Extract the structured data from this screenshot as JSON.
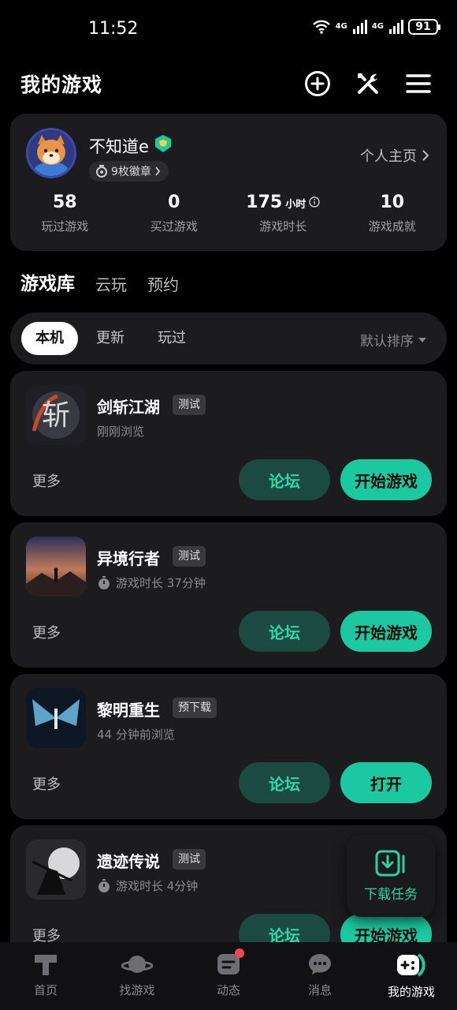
{
  "status_bar": {
    "time": "11:52",
    "signal_1": "4G",
    "signal_2": "4G",
    "battery": "91"
  },
  "header": {
    "title": "我的游戏"
  },
  "profile": {
    "username": "不知道e",
    "medals": "9枚徽章",
    "homepage_link": "个人主页",
    "stats": [
      {
        "value": "58",
        "unit": "",
        "label": "玩过游戏"
      },
      {
        "value": "0",
        "unit": "",
        "label": "买过游戏"
      },
      {
        "value": "175",
        "unit": "小时",
        "label": "游戏时长"
      },
      {
        "value": "10",
        "unit": "",
        "label": "游戏成就"
      }
    ]
  },
  "tabs": [
    "游戏库",
    "云玩",
    "预约"
  ],
  "filters": {
    "items": [
      "本机",
      "更新",
      "玩过"
    ],
    "sort": "默认排序"
  },
  "games": [
    {
      "name": "剑斩江湖",
      "tag": "测试",
      "sub": "刚刚浏览",
      "more": "更多",
      "forum": "论坛",
      "action": "开始游戏"
    },
    {
      "name": "异境行者",
      "tag": "测试",
      "sub": "游戏时长 37分钟",
      "more": "更多",
      "forum": "论坛",
      "action": "开始游戏"
    },
    {
      "name": "黎明重生",
      "tag": "预下载",
      "sub": "44 分钟前浏览",
      "more": "更多",
      "forum": "论坛",
      "action": "打开"
    },
    {
      "name": "遗迹传说",
      "tag": "测试",
      "sub": "游戏时长 4分钟",
      "more": "更多",
      "forum": "论坛",
      "action": "开始游戏"
    }
  ],
  "download_task": {
    "label": "下载任务"
  },
  "bottom_nav": [
    {
      "label": "首页",
      "icon": "home-icon"
    },
    {
      "label": "找游戏",
      "icon": "planet-icon"
    },
    {
      "label": "动态",
      "icon": "feed-icon"
    },
    {
      "label": "消息",
      "icon": "chat-icon"
    },
    {
      "label": "我的游戏",
      "icon": "gamepad-icon"
    }
  ],
  "colors": {
    "accent": "#1cc8a0",
    "card": "#1c1c1e",
    "forum_bg": "#1a4a40"
  }
}
